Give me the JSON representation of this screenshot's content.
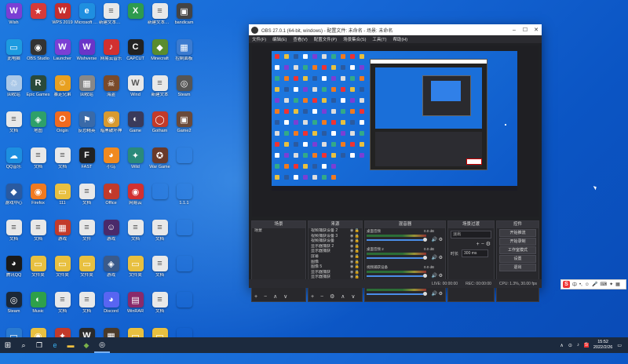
{
  "desktop_icons": [
    {
      "label": "Wish",
      "glyph": "W",
      "color": "#7b3fd4"
    },
    {
      "label": "",
      "glyph": "★",
      "color": "#d63a3a"
    },
    {
      "label": "WPS 2019",
      "glyph": "W",
      "color": "#c62d2d"
    },
    {
      "label": "Microsoft Edge",
      "glyph": "e",
      "color": "#1f8fe0"
    },
    {
      "label": "新建文本文档",
      "glyph": "≡",
      "color": "#e8e8e8"
    },
    {
      "label": "",
      "glyph": "X",
      "color": "#2e9b4e"
    },
    {
      "label": "新建文本文档",
      "glyph": "≡",
      "color": "#e8e8e8"
    },
    {
      "label": "bandicam",
      "glyph": "▣",
      "color": "#444"
    },
    {
      "label": "此电脑",
      "glyph": "▭",
      "color": "#1d9be0"
    },
    {
      "label": "OBS Studio",
      "glyph": "◉",
      "color": "#333"
    },
    {
      "label": "Launcher",
      "glyph": "W",
      "color": "#7b3fd4"
    },
    {
      "label": "Wishverse",
      "glyph": "W",
      "color": "#6a35c8"
    },
    {
      "label": "网易云音乐",
      "glyph": "♪",
      "color": "#d23030"
    },
    {
      "label": "CAPCUT",
      "glyph": "C",
      "color": "#222"
    },
    {
      "label": "Minecraft",
      "glyph": "◆",
      "color": "#5a8c2e"
    },
    {
      "label": "控制面板",
      "glyph": "▦",
      "color": "#3b7bd0"
    },
    {
      "label": "回收站",
      "glyph": "♲",
      "color": "#aac8e8"
    },
    {
      "label": "Epic Games",
      "glyph": "R",
      "color": "#2a4a3a"
    },
    {
      "label": "暴走兄弟",
      "glyph": "☺",
      "color": "#e8a020"
    },
    {
      "label": "回收站",
      "glyph": "▦",
      "color": "#888"
    },
    {
      "label": "海盗",
      "glyph": "☠",
      "color": "#7a4a2a"
    },
    {
      "label": "Wind",
      "glyph": "W",
      "color": "#e8e8e8"
    },
    {
      "label": "新建文本",
      "glyph": "≡",
      "color": "#e8e8e8"
    },
    {
      "label": "Steam",
      "glyph": "◎",
      "color": "#555"
    },
    {
      "label": "文档",
      "glyph": "≡",
      "color": "#e8e8e8"
    },
    {
      "label": "地图",
      "glyph": "◈",
      "color": "#2ea06a"
    },
    {
      "label": "Origin",
      "glyph": "O",
      "color": "#f06a20"
    },
    {
      "label": "反恐精英",
      "glyph": "⚑",
      "color": "#3a6aa8"
    },
    {
      "label": "暗黑破坏神",
      "glyph": "◉",
      "color": "#d89a30"
    },
    {
      "label": "Game",
      "glyph": "◐",
      "color": "#3a3a5a"
    },
    {
      "label": "Gotham",
      "glyph": "◯",
      "color": "#c23a2a"
    },
    {
      "label": "Game2",
      "glyph": "▣",
      "color": "#6a4a3a"
    },
    {
      "label": "QQ音乐",
      "glyph": "☁",
      "color": "#1d8fe0"
    },
    {
      "label": "文档",
      "glyph": "≡",
      "color": "#e8e8e8"
    },
    {
      "label": "文档",
      "glyph": "≡",
      "color": "#e8e8e8"
    },
    {
      "label": "FAST",
      "glyph": "F",
      "color": "#222"
    },
    {
      "label": "小鸟",
      "glyph": "◕",
      "color": "#f08a20"
    },
    {
      "label": "Wild",
      "glyph": "✦",
      "color": "#2a8a7a"
    },
    {
      "label": "War Game",
      "glyph": "✪",
      "color": "#6a3a2a"
    },
    {
      "label": "",
      "glyph": "",
      "color": "rgba(0,0,0,0)"
    },
    {
      "label": "游戏中心",
      "glyph": "◆",
      "color": "#2a5aa0"
    },
    {
      "label": "Firefox",
      "glyph": "◉",
      "color": "#f07a20"
    },
    {
      "label": "111",
      "glyph": "▭",
      "color": "#e8c040"
    },
    {
      "label": "文档",
      "glyph": "≡",
      "color": "#e8e8e8"
    },
    {
      "label": "Office",
      "glyph": "◐",
      "color": "#c23a2a"
    },
    {
      "label": "网易云",
      "glyph": "◉",
      "color": "#d23030"
    },
    {
      "label": "",
      "glyph": "",
      "color": "rgba(0,0,0,0)"
    },
    {
      "label": "1.1.1",
      "glyph": "",
      "color": "rgba(0,0,0,0)"
    },
    {
      "label": "文档",
      "glyph": "≡",
      "color": "#e8e8e8"
    },
    {
      "label": "文档",
      "glyph": "≡",
      "color": "#e8e8e8"
    },
    {
      "label": "游戏",
      "glyph": "▦",
      "color": "#c23a2a"
    },
    {
      "label": "文件",
      "glyph": "≡",
      "color": "#e8e8e8"
    },
    {
      "label": "游戏",
      "glyph": "☺",
      "color": "#4a2a6a"
    },
    {
      "label": "文档",
      "glyph": "≡",
      "color": "#e8e8e8"
    },
    {
      "label": "文档",
      "glyph": "≡",
      "color": "#e8e8e8"
    },
    {
      "label": "",
      "glyph": "",
      "color": "rgba(0,0,0,0)"
    },
    {
      "label": "腾讯QQ",
      "glyph": "◕",
      "color": "#1a1a1a"
    },
    {
      "label": "文件夹",
      "glyph": "▭",
      "color": "#e8c040"
    },
    {
      "label": "文件夹",
      "glyph": "▭",
      "color": "#e8c040"
    },
    {
      "label": "文件夹",
      "glyph": "▭",
      "color": "#e8c040"
    },
    {
      "label": "游戏",
      "glyph": "◈",
      "color": "#3a5a8a"
    },
    {
      "label": "文件夹",
      "glyph": "▭",
      "color": "#e8c040"
    },
    {
      "label": "文档",
      "glyph": "≡",
      "color": "#e8e8e8"
    },
    {
      "label": "",
      "glyph": "",
      "color": "rgba(0,0,0,0)"
    },
    {
      "label": "Steam",
      "glyph": "◎",
      "color": "#1b2838"
    },
    {
      "label": "Music",
      "glyph": "◐",
      "color": "#2ea04a"
    },
    {
      "label": "文档",
      "glyph": "≡",
      "color": "#e8e8e8"
    },
    {
      "label": "文档",
      "glyph": "≡",
      "color": "#e8e8e8"
    },
    {
      "label": "Discord",
      "glyph": "◕",
      "color": "#5865f2"
    },
    {
      "label": "WinRAR",
      "glyph": "▤",
      "color": "#8a2a6a"
    },
    {
      "label": "文档",
      "glyph": "≡",
      "color": "#e8e8e8"
    },
    {
      "label": "",
      "glyph": "",
      "color": "rgba(0,0,0,0)"
    },
    {
      "label": "桌面",
      "glyph": "▭",
      "color": "#2a7ad0"
    },
    {
      "label": "Logo",
      "glyph": "◉",
      "color": "#e8c040"
    },
    {
      "label": "Game",
      "glyph": "✦",
      "color": "#c23a2a"
    },
    {
      "label": "Warcraft",
      "glyph": "W",
      "color": "#2a2a2a"
    },
    {
      "label": "游戏",
      "glyph": "▦",
      "color": "#4a3a2a"
    },
    {
      "label": "文件夹",
      "glyph": "▭",
      "color": "#e8c040"
    },
    {
      "label": "文件夹",
      "glyph": "▭",
      "color": "#e8c040"
    },
    {
      "label": "",
      "glyph": "",
      "color": "rgba(0,0,0,0)"
    }
  ],
  "obs": {
    "title": "OBS 27.0.1 (64-bit, windows) - 配置文件: 未命名 - 场景: 未命名",
    "menu": [
      "文件(F)",
      "编辑(E)",
      "查看(V)",
      "配置文件(P)",
      "场景集合(S)",
      "工具(T)",
      "帮助(H)"
    ],
    "scenes": {
      "header": "场景",
      "items": [
        "场景"
      ],
      "footer": "+ − ∧ ∨"
    },
    "sources": {
      "header": "来源",
      "items": [
        "视频捕获设备 2",
        "视频捕获设备 3",
        "视频捕获设备",
        "显示器捕获 2",
        "显示器捕获",
        "屏幕",
        "图像",
        "图像 5",
        "显示器捕获",
        "显示器捕获"
      ],
      "footer": "+ − ⚙ ∧ ∨"
    },
    "mixer": {
      "header": "混音器",
      "channels": [
        {
          "name": "桌面音频",
          "db": "0.0 dB"
        },
        {
          "name": "桌面音频 2",
          "db": "0.0 dB"
        },
        {
          "name": "视频捕获设备",
          "db": "0.0 dB"
        },
        {
          "name": "视频捕获设备 2",
          "db": "0.0 dB"
        }
      ]
    },
    "transitions": {
      "header": "场景过渡",
      "type": "淡出",
      "duration_label": "时长",
      "duration": "300 ms"
    },
    "controls": {
      "header": "控件",
      "buttons": [
        "开始推流",
        "开始录制",
        "工作室模式",
        "设置",
        "退出"
      ]
    },
    "status": {
      "live": "LIVE: 00:00:00",
      "rec": "REC: 00:00:00",
      "cpu": "CPU: 1.3%, 30.00 fps"
    }
  },
  "taskbar": {
    "time": "15:52",
    "date": "2022/2/26"
  },
  "ime": {
    "label": "中"
  }
}
